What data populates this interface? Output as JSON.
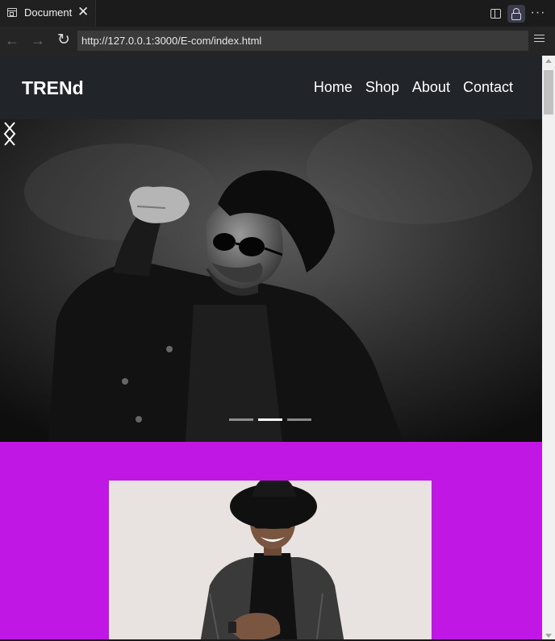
{
  "browser": {
    "tab_title": "Document",
    "url": "http://127.0.0.1:3000/E-com/index.html",
    "icons": [
      "document-tab-icon",
      "close-icon",
      "split-view-icon",
      "lock-icon",
      "more-icon",
      "back-arrow-icon",
      "forward-arrow-icon",
      "reload-icon",
      "menu-icon"
    ]
  },
  "site": {
    "brand": "TRENd",
    "nav": [
      "Home",
      "Shop",
      "About",
      "Contact"
    ]
  },
  "carousel": {
    "slide_count": 3,
    "active_slide": 2,
    "image": "black-and-white photo of man in sunglasses and jacket",
    "icons": [
      "chevron-left-icon",
      "chevron-right-icon"
    ]
  },
  "promo": {
    "background": "#c017e4",
    "image": "smiling man in black hat and glasses"
  },
  "colors": {
    "navbar": "#212529",
    "accent": "#c017e4",
    "chrome": "#252526"
  }
}
